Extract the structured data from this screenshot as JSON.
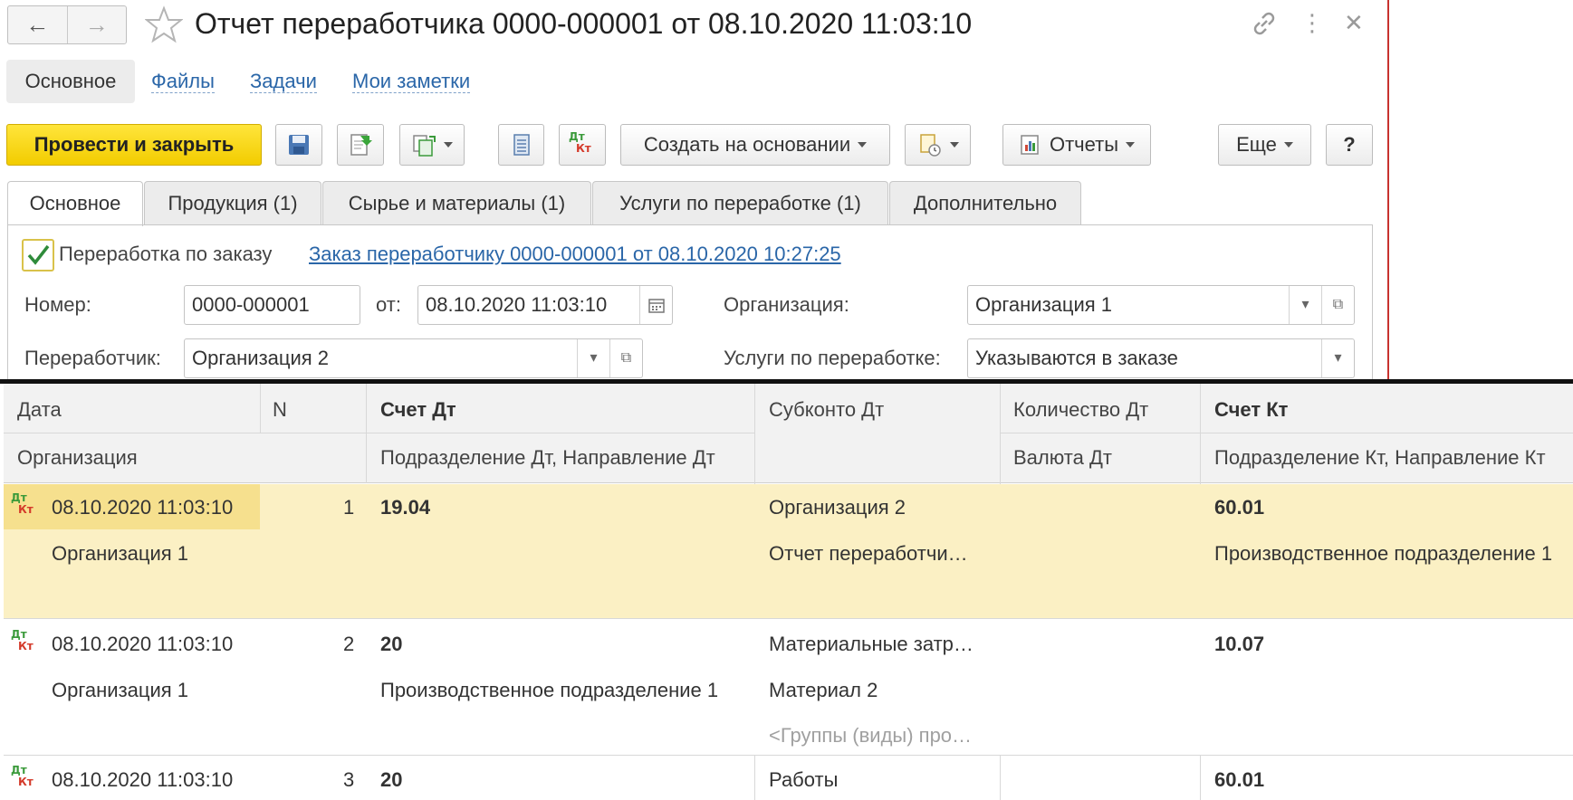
{
  "window": {
    "title": "Отчет переработчика 0000-000001 от 08.10.2020 11:03:10"
  },
  "top_tabs": [
    {
      "label": "Основное"
    },
    {
      "label": "Файлы"
    },
    {
      "label": "Задачи"
    },
    {
      "label": "Мои заметки"
    }
  ],
  "toolbar": {
    "post_close": "Провести и закрыть",
    "create_based": "Создать на основании",
    "reports": "Отчеты",
    "more": "Еще",
    "help": "?"
  },
  "form_tabs": [
    {
      "label": "Основное"
    },
    {
      "label": "Продукция (1)"
    },
    {
      "label": "Сырье и материалы (1)"
    },
    {
      "label": "Услуги по переработке (1)"
    },
    {
      "label": "Дополнительно"
    }
  ],
  "form": {
    "order_checkbox_label": "Переработка по заказу",
    "order_link": "Заказ переработчику 0000-000001 от 08.10.2020 10:27:25",
    "number_label": "Номер:",
    "number_value": "0000-000001",
    "date_label": "от:",
    "date_value": "08.10.2020 11:03:10",
    "org_label": "Организация:",
    "org_value": "Организация 1",
    "processor_label": "Переработчик:",
    "processor_value": "Организация 2",
    "services_label": "Услуги по переработке:",
    "services_value": "Указываются в заказе"
  },
  "grid": {
    "headers": {
      "date": "Дата",
      "n": "N",
      "debit_account": "Счет Дт",
      "debit_subconto": "Субконто Дт",
      "debit_qty": "Количество Дт",
      "credit_account": "Счет Кт",
      "organization": "Организация",
      "debit_division": "Подразделение Дт, Направление Дт",
      "debit_currency": "Валюта Дт",
      "credit_division": "Подразделение Кт, Направление Кт"
    },
    "rows": [
      {
        "date": "08.10.2020 11:03:10",
        "n": "1",
        "debit_account": "19.04",
        "organization": "Организация 1",
        "debit_division": "",
        "subconto": [
          "Организация 2",
          "Отчет переработчи…",
          ""
        ],
        "credit_account": "60.01",
        "credit_division": "Производственное подразделение 1"
      },
      {
        "date": "08.10.2020 11:03:10",
        "n": "2",
        "debit_account": "20",
        "organization": "Организация 1",
        "debit_division": "Производственное подразделение 1",
        "subconto": [
          "Материальные затр…",
          "Материал 2",
          "<Группы (виды) про…"
        ],
        "credit_account": "10.07",
        "credit_division": ""
      },
      {
        "date": "08.10.2020 11:03:10",
        "n": "3",
        "debit_account": "20",
        "organization": "",
        "debit_division": "",
        "subconto": [
          "Работы",
          "",
          ""
        ],
        "credit_account": "60.01",
        "credit_division": ""
      }
    ],
    "dtkt_icon": {
      "dt": "Дт",
      "kt": "Кт"
    }
  },
  "colors": {
    "accent_yellow": "#f5d200",
    "selected_row": "#fbf0c4",
    "link_blue": "#2a66a8",
    "divider_red": "#c8332f"
  },
  "icons": [
    "back-arrow-icon",
    "forward-arrow-icon",
    "star-icon",
    "link-icon",
    "more-vertical-icon",
    "close-icon",
    "save-icon",
    "post-icon",
    "copy-icon",
    "list-icon",
    "dtkt-icon",
    "calendar-icon",
    "open-icon",
    "report-icon"
  ]
}
